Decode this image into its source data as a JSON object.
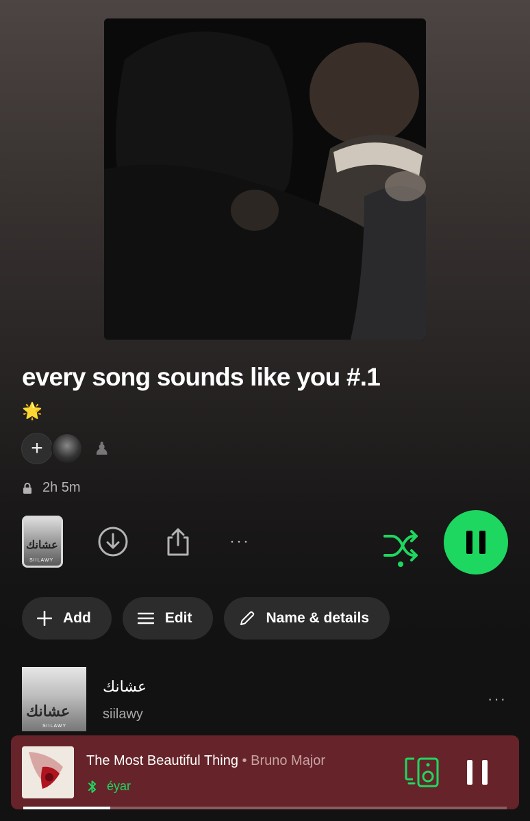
{
  "playlist": {
    "title": "every song sounds like you #.1",
    "description": "🌟",
    "duration": "2h 5m",
    "collaborators": {
      "add_symbol": "+",
      "extra_symbol": "♟"
    }
  },
  "controls": {
    "mini_cover_text": "عشانك",
    "mini_cover_label": "SIILAWY",
    "more_symbol": "···"
  },
  "actions": {
    "add_label": "Add",
    "edit_label": "Edit",
    "details_label": "Name & details"
  },
  "tracks": [
    {
      "title": "عشانك",
      "artist": "siilawy",
      "art_text": "عشانك",
      "art_label": "SIILAWY",
      "more": "···"
    }
  ],
  "now_playing": {
    "title": "The Most Beautiful Thing",
    "separator": " • ",
    "artist": "Bruno Major",
    "device": "éyar",
    "progress": 0.18
  },
  "colors": {
    "accent": "#1ed760",
    "now_playing_bg": "#66242a",
    "pill_bg": "#2c2c2c"
  },
  "icons": {
    "lock": "lock-icon",
    "download": "download-icon",
    "share": "share-icon",
    "shuffle": "shuffle-icon",
    "pause": "pause-icon",
    "bluetooth": "bluetooth-icon",
    "connect": "connect-device-icon",
    "pencil": "pencil-icon",
    "menu": "menu-icon",
    "plus": "plus-icon"
  }
}
